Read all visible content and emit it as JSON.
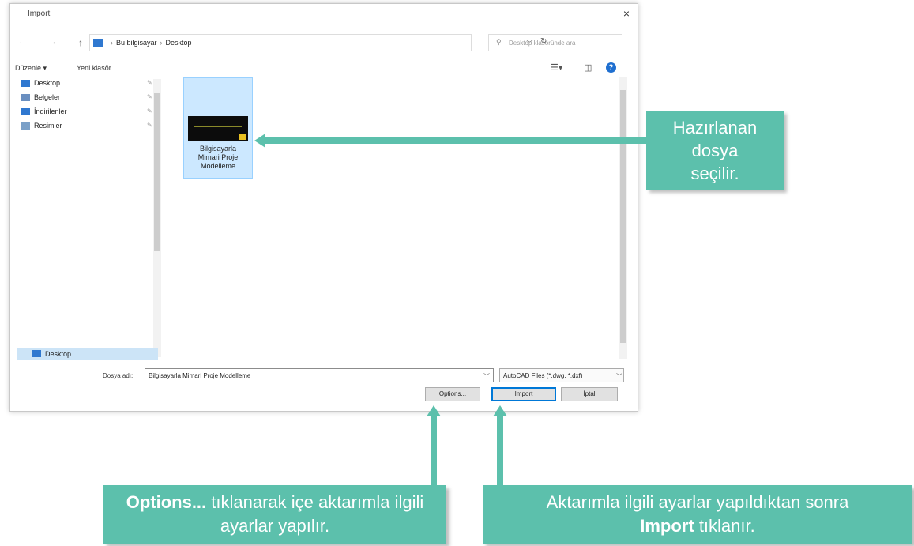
{
  "dialog": {
    "title": "Import",
    "close_glyph": "×",
    "address": {
      "crumbs": [
        "Bu bilgisayar",
        "Desktop"
      ],
      "separator": "›",
      "search_placeholder": "Desktop klasöründe ara"
    },
    "toolbar": {
      "organize_label": "Düzenle ▾",
      "new_folder_label": "Yeni klasör"
    },
    "nav_items": [
      {
        "label": "Desktop",
        "icon": "desktop-folder-icon",
        "color": "#2f78d0"
      },
      {
        "label": "Belgeler",
        "icon": "documents-icon",
        "color": "#6a8fc0"
      },
      {
        "label": "İndirilenler",
        "icon": "downloads-icon",
        "color": "#2f78d0"
      },
      {
        "label": "Resimler",
        "icon": "pictures-icon",
        "color": "#7aa0c8"
      }
    ],
    "nav_bottom_label": "Desktop",
    "file": {
      "name_lines": [
        "Bilgisayarla",
        "Mimari Proje",
        "Modelleme"
      ]
    },
    "filename_label": "Dosya adı:",
    "filename_value": "Bilgisayarla Mimari Proje Modelleme",
    "filetype_value": "AutoCAD Files (*.dwg, *.dxf)",
    "buttons": {
      "options": "Options...",
      "import": "Import",
      "cancel": "İptal"
    }
  },
  "callouts": {
    "file_selected": [
      "Hazırlanan",
      "dosya",
      "seçilir."
    ],
    "options_bold": "Options...",
    "options_rest": " tıklanarak içe aktarımla ilgili",
    "options_line2": "ayarlar yapılır.",
    "import_line1": "Aktarımla ilgili ayarlar yapıldıktan sonra",
    "import_bold": "Import",
    "import_rest": " tıklanır."
  },
  "colors": {
    "accent_teal": "#5cc0ac",
    "selection": "#cce8ff",
    "primary_blue": "#0078d7"
  }
}
